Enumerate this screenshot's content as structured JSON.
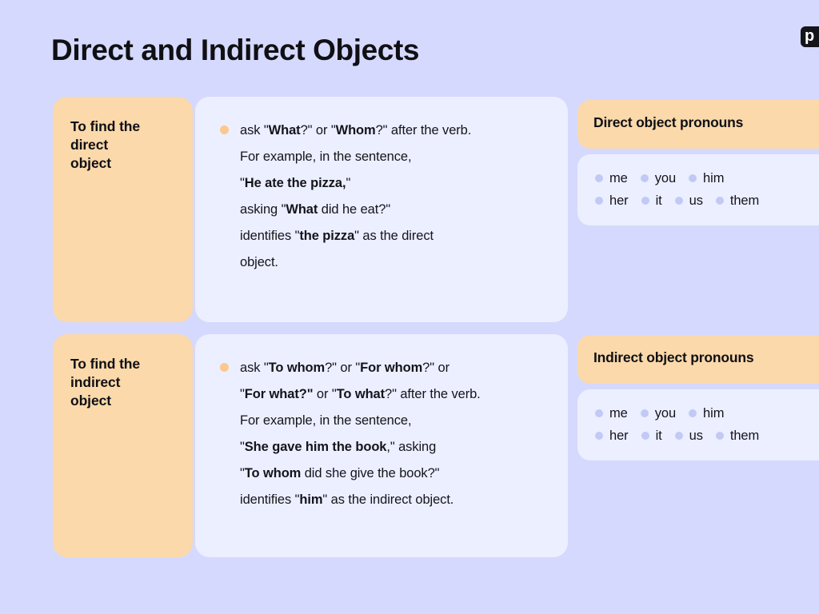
{
  "page": {
    "title": "Direct and Indirect Objects",
    "background_color": "#d5d9fd",
    "accent_orange": "#fbd9ab",
    "card_color": "#ecefff",
    "bullet_orange": "#fbc88d",
    "bullet_lavender": "#c3c9f5"
  },
  "logo": {
    "text": "p"
  },
  "sections": [
    {
      "label": "To find the\ndirect\nobject",
      "lines": [
        [
          {
            "t": "ask \"",
            "b": false
          },
          {
            "t": "What",
            "b": true
          },
          {
            "t": "?\" or \"",
            "b": false
          },
          {
            "t": "Whom",
            "b": true
          },
          {
            "t": "?\" after the verb.",
            "b": false
          }
        ],
        [
          {
            "t": "For example, in the sentence,",
            "b": false
          }
        ],
        [
          {
            "t": "\"",
            "b": false
          },
          {
            "t": "He ate the pizza,",
            "b": true
          },
          {
            "t": "\"",
            "b": false
          }
        ],
        [
          {
            "t": "asking \"",
            "b": false
          },
          {
            "t": "What",
            "b": true
          },
          {
            "t": " did he eat?\"",
            "b": false
          }
        ],
        [
          {
            "t": "identifies \"",
            "b": false
          },
          {
            "t": "the pizza",
            "b": true
          },
          {
            "t": "\" as the direct",
            "b": false
          }
        ],
        [
          {
            "t": "object.",
            "b": false
          }
        ]
      ],
      "pronoun_title": "Direct object pronouns",
      "pronouns_row1": [
        "me",
        "you",
        "him"
      ],
      "pronouns_row2": [
        "her",
        "it",
        "us",
        "them"
      ]
    },
    {
      "label": "To find the\nindirect\nobject",
      "lines": [
        [
          {
            "t": "ask \"",
            "b": false
          },
          {
            "t": "To whom",
            "b": true
          },
          {
            "t": "?\" or \"",
            "b": false
          },
          {
            "t": "For whom",
            "b": true
          },
          {
            "t": "?\" or",
            "b": false
          }
        ],
        [
          {
            "t": "\"",
            "b": false
          },
          {
            "t": "For what?\"",
            "b": true
          },
          {
            "t": " or \"",
            "b": false
          },
          {
            "t": "To what",
            "b": true
          },
          {
            "t": "?\" after the verb.",
            "b": false
          }
        ],
        [
          {
            "t": "For example, in the sentence,",
            "b": false
          }
        ],
        [
          {
            "t": "\"",
            "b": false
          },
          {
            "t": "She gave him the book",
            "b": true
          },
          {
            "t": ",\" asking",
            "b": false
          }
        ],
        [
          {
            "t": "\"",
            "b": false
          },
          {
            "t": "To whom",
            "b": true
          },
          {
            "t": " did she give the book?\"",
            "b": false
          }
        ],
        [
          {
            "t": "identifies \"",
            "b": false
          },
          {
            "t": "him",
            "b": true
          },
          {
            "t": "\" as the indirect object.",
            "b": false
          }
        ]
      ],
      "pronoun_title": "Indirect object pronouns",
      "pronouns_row1": [
        "me",
        "you",
        "him"
      ],
      "pronouns_row2": [
        "her",
        "it",
        "us",
        "them"
      ]
    }
  ]
}
